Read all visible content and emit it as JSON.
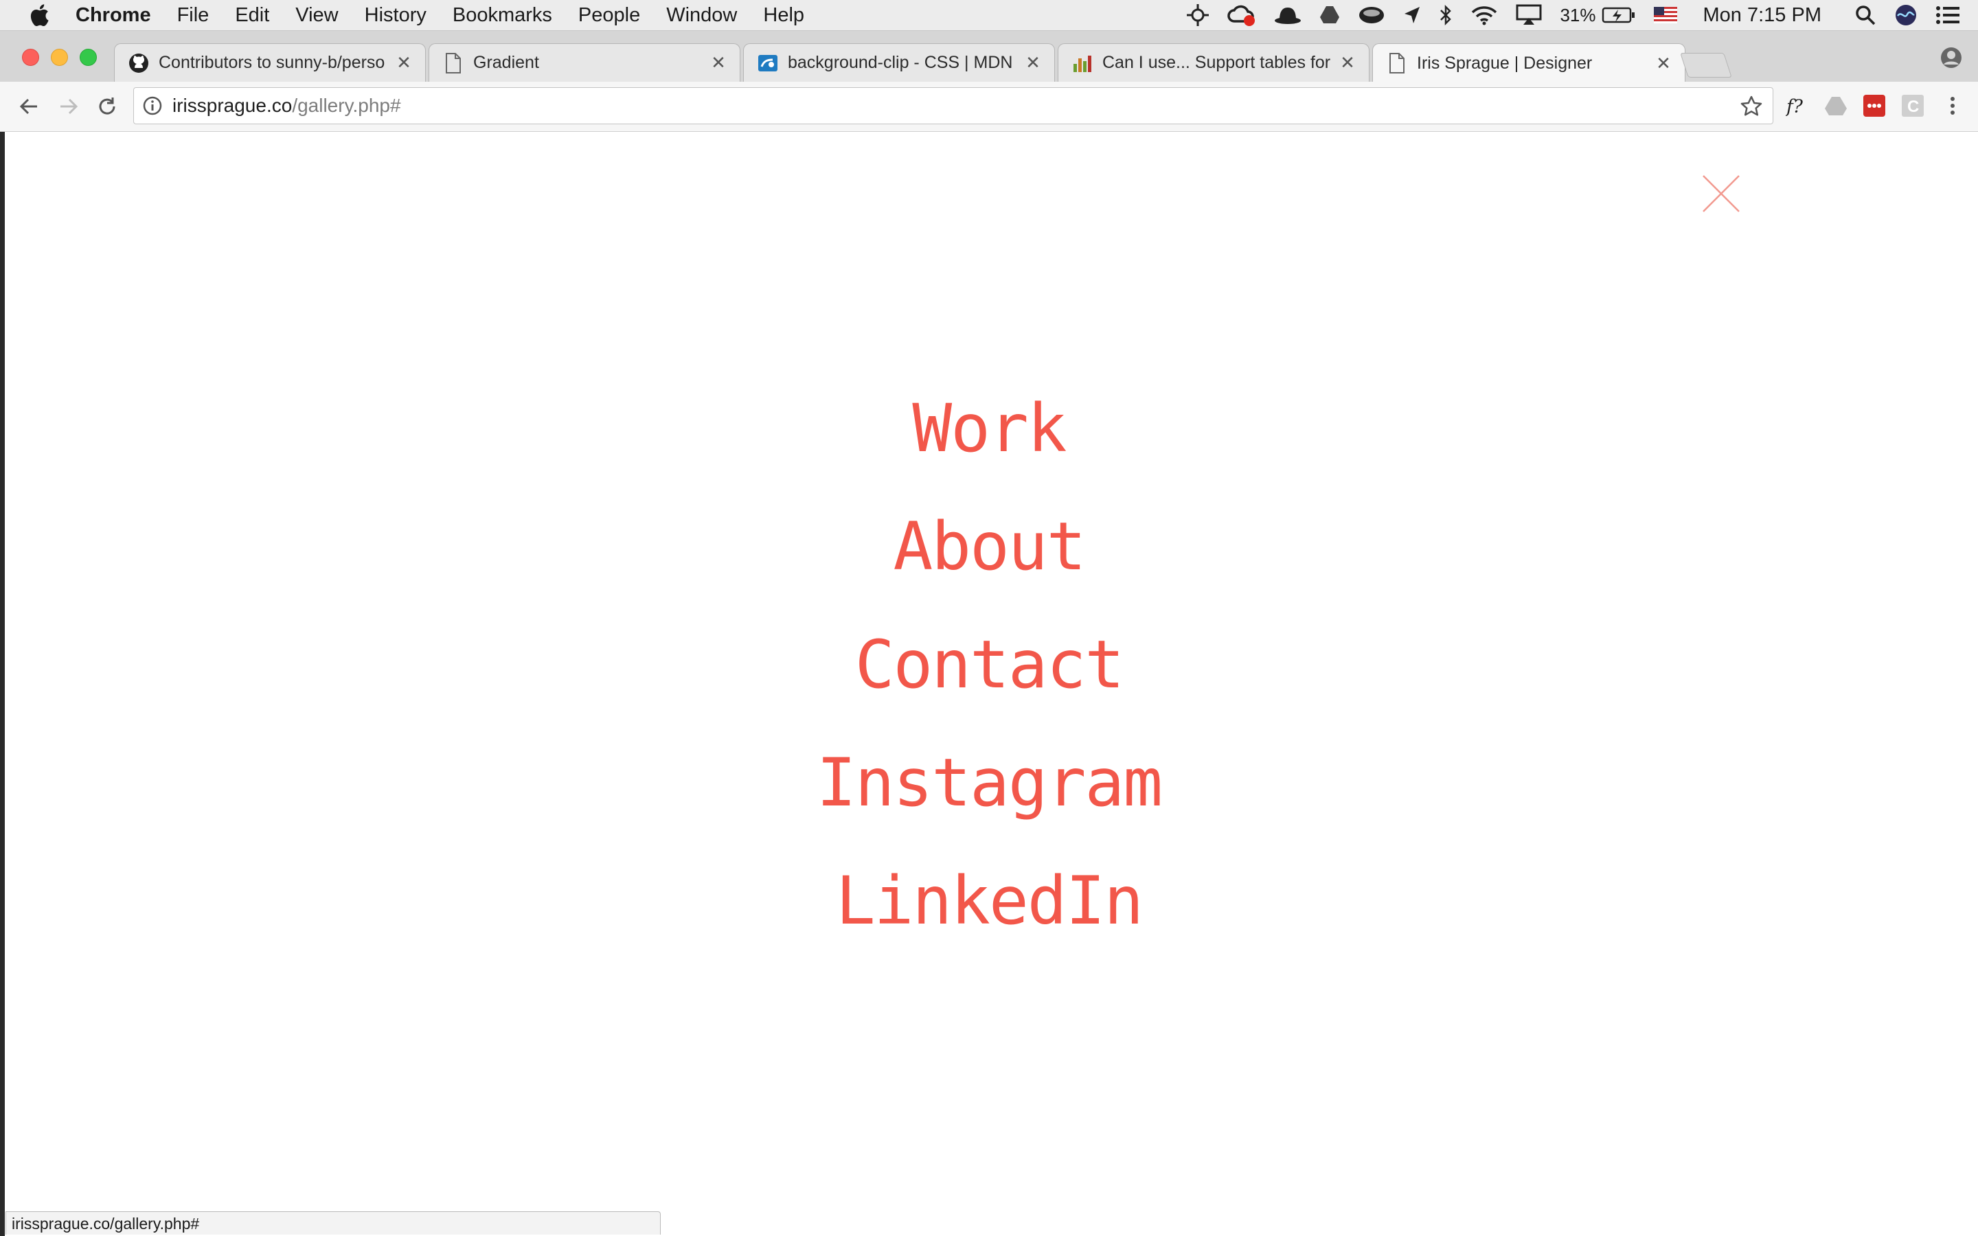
{
  "menubar": {
    "app_name": "Chrome",
    "items": [
      "File",
      "Edit",
      "View",
      "History",
      "Bookmarks",
      "People",
      "Window",
      "Help"
    ],
    "battery_percent": "31%",
    "clock": "Mon 7:15 PM"
  },
  "tabs": [
    {
      "title": "Contributors to sunny-b/perso",
      "icon": "github-icon"
    },
    {
      "title": "Gradient",
      "icon": "page-icon"
    },
    {
      "title": "background-clip - CSS | MDN",
      "icon": "mdn-icon"
    },
    {
      "title": "Can I use... Support tables for",
      "icon": "caniuse-icon"
    },
    {
      "title": "Iris Sprague | Designer",
      "icon": "page-icon",
      "active": true
    }
  ],
  "omnibox": {
    "host": "irissprague.co",
    "path": "/gallery.php#"
  },
  "extensions": [
    "whatfont-icon",
    "drive-icon",
    "lastpass-icon",
    "c-extension-icon"
  ],
  "page": {
    "close_label": "close-icon",
    "nav": {
      "work": "Work",
      "about": "About",
      "contact": "Contact",
      "instagram": "Instagram",
      "linkedin": "LinkedIn"
    },
    "accent_color": "#f2574a"
  },
  "status_bubble": "irissprague.co/gallery.php#"
}
